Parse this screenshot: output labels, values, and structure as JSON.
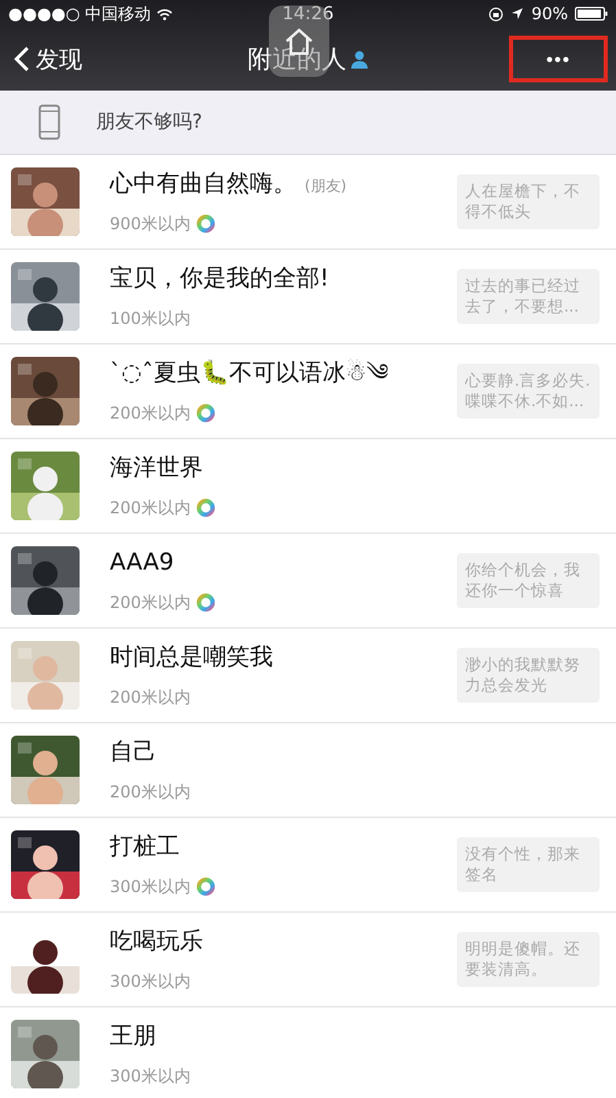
{
  "status_bar": {
    "carrier": "●●●●○ 中国移动",
    "time": "14:26",
    "battery": "90%"
  },
  "nav": {
    "back": "发现",
    "title": "附近的人",
    "more": "•••",
    "more_highlighted": true
  },
  "tip": {
    "text": "朋友不够吗?"
  },
  "people": [
    {
      "name": "心中有曲自然嗨。",
      "tag": "(朋友)",
      "distance": "900米以内",
      "moments": true,
      "signature": "人在屋檐下，不得不低头"
    },
    {
      "name": "宝贝，你是我的全部!",
      "distance": "100米以内",
      "moments": false,
      "signature": "过去的事已经过去了，不要想..."
    },
    {
      "name": "ˋ◌ˆ夏虫🐛不可以语冰☃༄",
      "distance": "200米以内",
      "moments": true,
      "signature": "心要静.言多必失.喋喋不休.不如..."
    },
    {
      "name": "海洋世界",
      "distance": "200米以内",
      "moments": true
    },
    {
      "name": "AAA9",
      "distance": "200米以内",
      "moments": true,
      "signature": "你给个机会，我还你一个惊喜"
    },
    {
      "name": "时间总是嘲笑我",
      "distance": "200米以内",
      "moments": false,
      "signature": "渺小的我默默努力总会发光"
    },
    {
      "name": "自己",
      "distance": "200米以内",
      "moments": false
    },
    {
      "name": "打桩工",
      "distance": "300米以内",
      "moments": true,
      "signature": "没有个性，那来签名"
    },
    {
      "name": "吃喝玩乐",
      "distance": "300米以内",
      "moments": false,
      "signature": "明明是傻帽。还要装清高。"
    },
    {
      "name": "王朋",
      "distance": "300米以内",
      "moments": false
    }
  ]
}
